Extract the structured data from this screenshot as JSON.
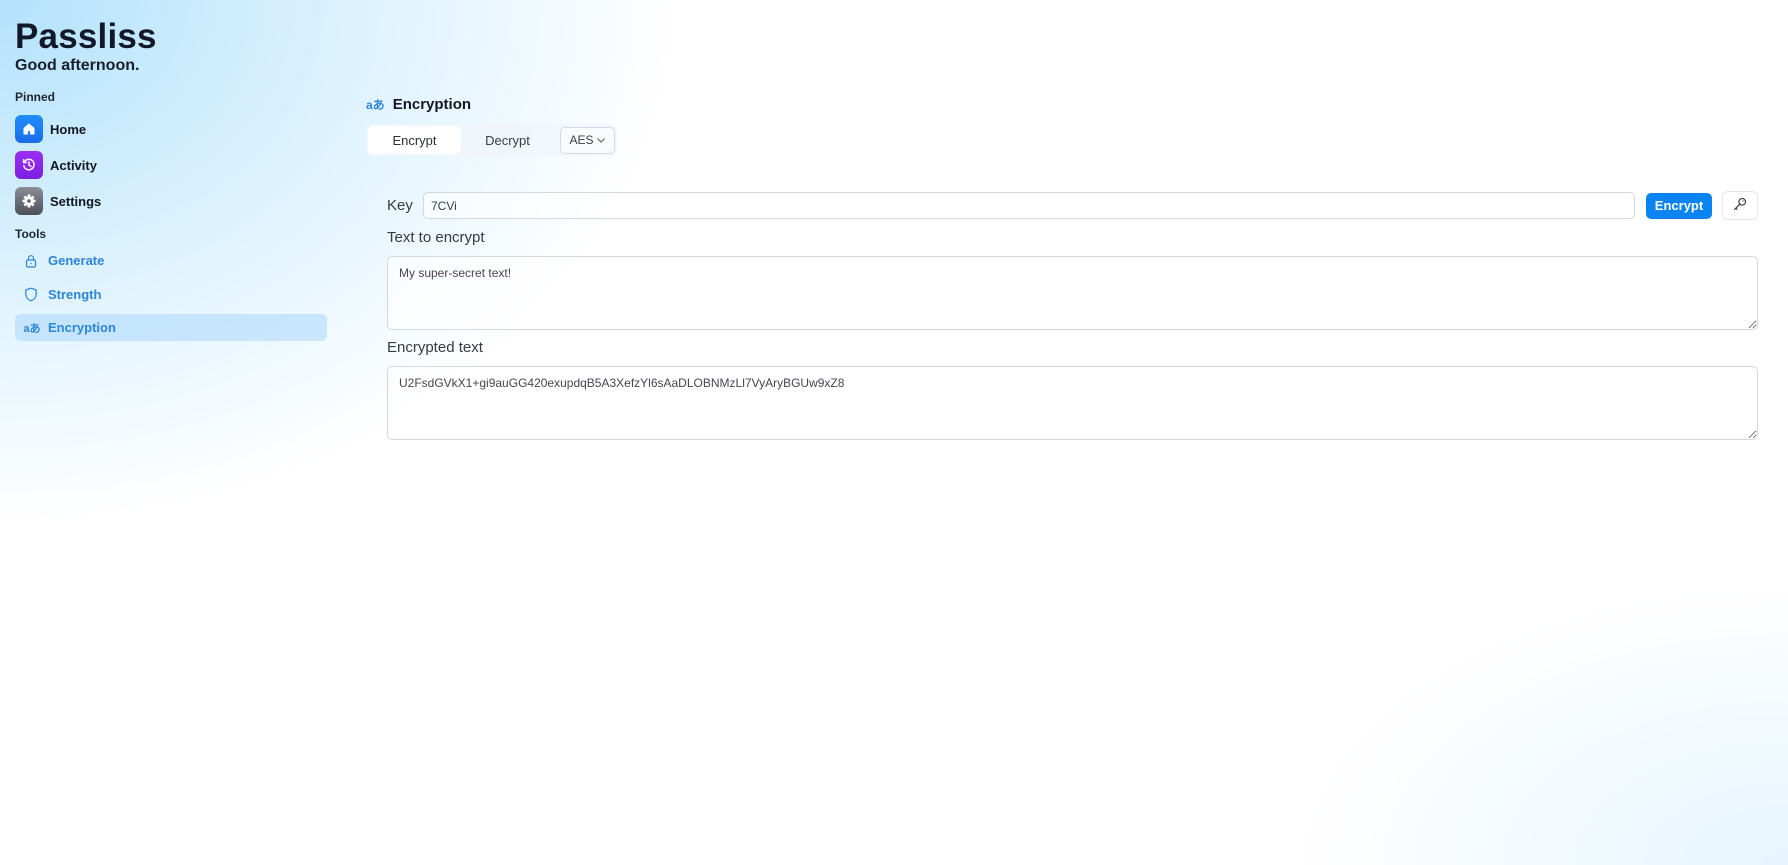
{
  "app": {
    "title": "Passliss",
    "greeting": "Good afternoon."
  },
  "sidebar": {
    "pinned_label": "Pinned",
    "pinned": [
      {
        "label": "Home",
        "icon": "home-icon",
        "color": "#1a7cf2"
      },
      {
        "label": "Activity",
        "icon": "history-icon",
        "color": "#8a25ea"
      },
      {
        "label": "Settings",
        "icon": "gear-icon",
        "color": "#6b6e76"
      }
    ],
    "tools_label": "Tools",
    "tools": [
      {
        "label": "Generate",
        "icon": "lock-icon",
        "active": false
      },
      {
        "label": "Strength",
        "icon": "shield-icon",
        "active": false
      },
      {
        "label": "Encryption",
        "icon": "translate-icon",
        "active": true
      }
    ]
  },
  "main": {
    "header": {
      "icon": "translate-icon",
      "icon_glyph": "aあ",
      "title": "Encryption"
    },
    "tabs": [
      {
        "label": "Encrypt",
        "active": true
      },
      {
        "label": "Decrypt",
        "active": false
      }
    ],
    "algorithm": {
      "selected": "AES"
    },
    "key": {
      "label": "Key",
      "value": "7CVi"
    },
    "encrypt_button": "Encrypt",
    "text_to_encrypt": {
      "label": "Text to encrypt",
      "value": "My super-secret text!"
    },
    "encrypted_text": {
      "label": "Encrypted text",
      "value": "U2FsdGVkX1+gi9auGG420exupdqB5A3XefzYl6sAaDLOBNMzLl7VyAryBGUw9xZ8"
    }
  },
  "colors": {
    "accent": "#0a84f0",
    "sidebar_link": "#2d86d6",
    "active_item_bg": "#cfe6fb"
  }
}
